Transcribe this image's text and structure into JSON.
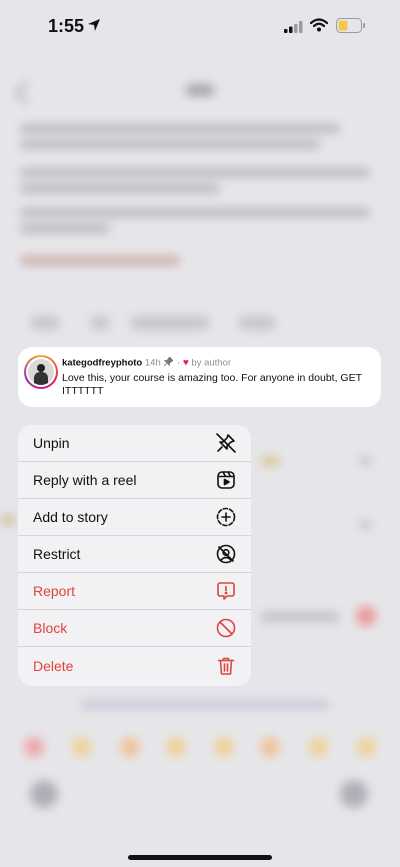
{
  "status_bar": {
    "time": "1:55"
  },
  "comment": {
    "username": "kategodfreyphoto",
    "age": "14h",
    "separator": "·",
    "author_badge": "by author",
    "text": "Love this, your course is amazing too. For anyone in doubt, GET ITTTTTT"
  },
  "menu": {
    "items": [
      {
        "label": "Unpin",
        "icon": "unpin-icon"
      },
      {
        "label": "Reply with a reel",
        "icon": "reel-icon"
      },
      {
        "label": "Add to story",
        "icon": "add-story-icon"
      },
      {
        "label": "Restrict",
        "icon": "restrict-icon"
      },
      {
        "label": "Report",
        "icon": "report-icon"
      },
      {
        "label": "Block",
        "icon": "block-icon"
      },
      {
        "label": "Delete",
        "icon": "trash-icon"
      }
    ]
  },
  "colors": {
    "danger": "#e0443e",
    "heart": "#e0245e",
    "text": "#111111"
  }
}
